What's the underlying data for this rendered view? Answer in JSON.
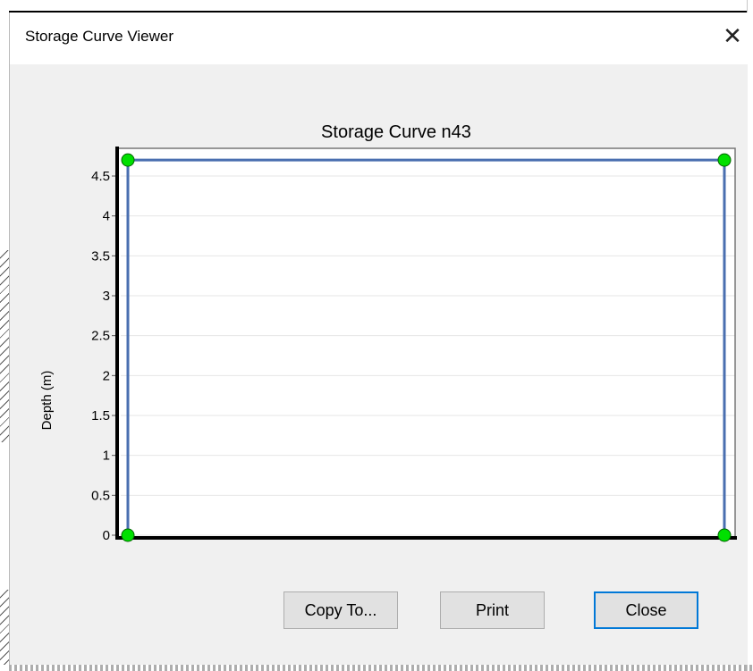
{
  "window": {
    "title": "Storage Curve Viewer",
    "close_glyph": "✕"
  },
  "chart_data": {
    "type": "line",
    "title": "Storage Curve n43",
    "xlabel": "",
    "ylabel": "Depth (m)",
    "ylim": [
      0,
      4.7
    ],
    "yticks": [
      "0",
      "0.5",
      "1",
      "1.5",
      "2",
      "2.5",
      "3",
      "3.5",
      "4",
      "4.5"
    ],
    "xlim": [
      0,
      1
    ],
    "grid": true,
    "series": [
      {
        "line_color": "#4a6fb0",
        "marker_color": "#00e000",
        "points": [
          {
            "x": 0,
            "y": 0
          },
          {
            "x": 0,
            "y": 4.7
          },
          {
            "x": 1,
            "y": 4.7
          },
          {
            "x": 1,
            "y": 0
          }
        ]
      }
    ]
  },
  "buttons": {
    "copy_to": "Copy To...",
    "print": "Print",
    "close": "Close"
  },
  "icons": {
    "close": "close-icon"
  }
}
